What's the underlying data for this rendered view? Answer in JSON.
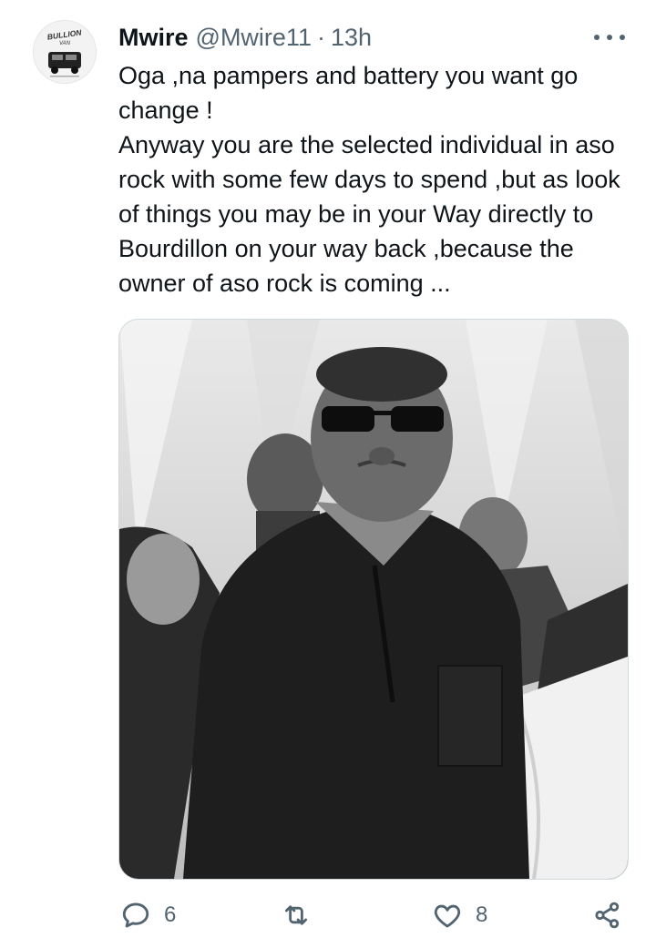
{
  "tweet": {
    "avatar_text_1": "BULLION",
    "avatar_text_2": "VAN",
    "author_name": "Mwire",
    "author_handle": "@Mwire11",
    "separator": "·",
    "time": "13h",
    "text": "Oga ,na pampers and battery you want go change !\nAnyway you are the selected individual in aso rock with some few days to spend ,but as look of things you may be in your Way directly to Bourdillon on your way back ,because the owner of aso rock is coming ...",
    "actions": {
      "reply_count": "6",
      "like_count": "8"
    }
  },
  "icons": [
    "more-icon",
    "reply-icon",
    "retweet-icon",
    "like-icon",
    "share-icon"
  ],
  "colors": {
    "text": "#0f1419",
    "secondary": "#536471",
    "border": "#cfd9de"
  }
}
